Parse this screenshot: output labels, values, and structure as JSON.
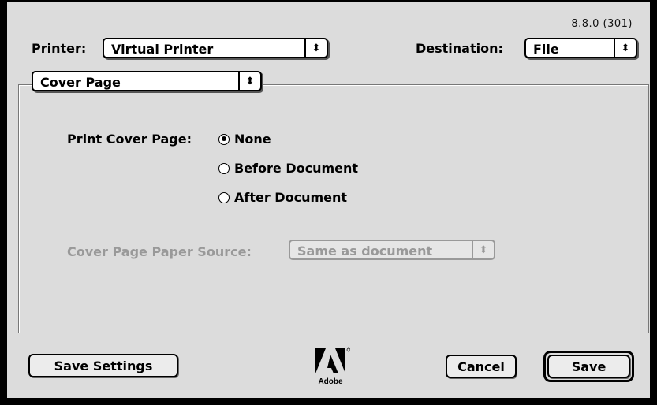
{
  "version": "8.8.0 (301)",
  "printer": {
    "label": "Printer:",
    "value": "Virtual Printer"
  },
  "destination": {
    "label": "Destination:",
    "value": "File"
  },
  "panel": {
    "value": "Cover Page"
  },
  "cover_page": {
    "label": "Print Cover Page:",
    "options": [
      {
        "label": "None",
        "selected": true
      },
      {
        "label": "Before Document",
        "selected": false
      },
      {
        "label": "After Document",
        "selected": false
      }
    ]
  },
  "paper_source": {
    "label": "Cover Page Paper Source:",
    "value": "Same as document",
    "enabled": false
  },
  "logo": {
    "text": "Adobe"
  },
  "buttons": {
    "save_settings": "Save Settings",
    "cancel": "Cancel",
    "save": "Save"
  }
}
